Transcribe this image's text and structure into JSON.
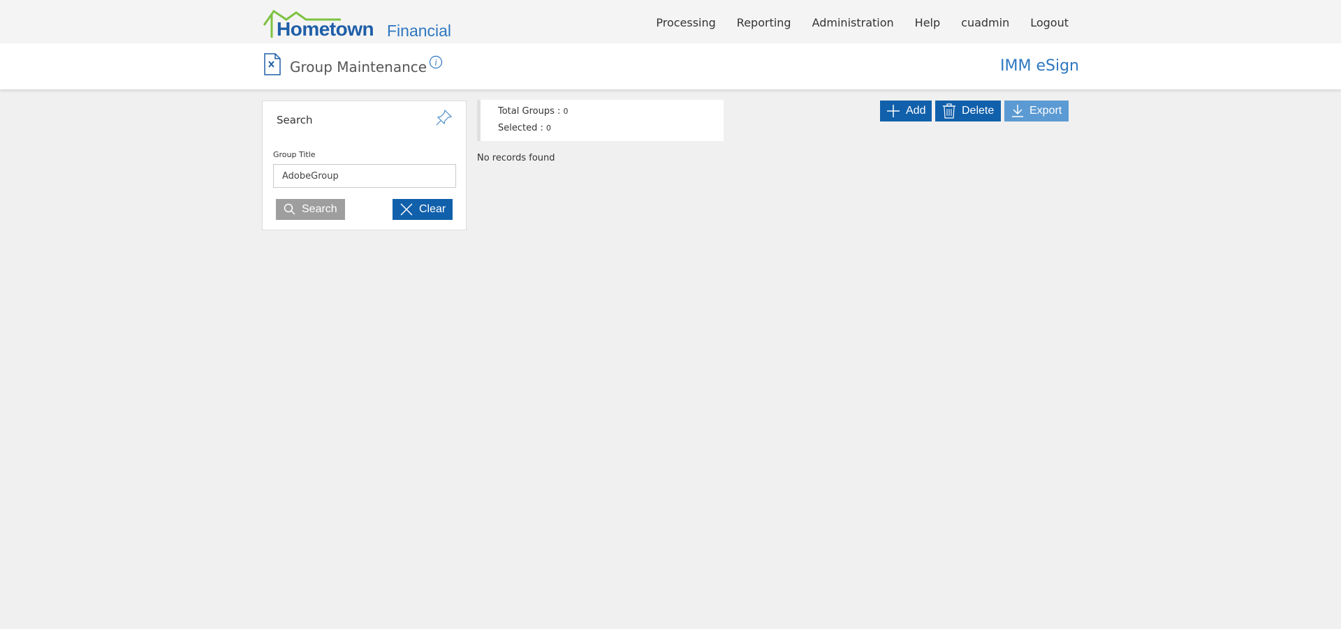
{
  "header": {
    "brand_main": "Hometown",
    "brand_sub": "Financial",
    "nav": [
      "Processing",
      "Reporting",
      "Administration",
      "Help",
      "cuadmin",
      "Logout"
    ]
  },
  "page": {
    "title": "Group Maintenance",
    "app_name": "IMM eSign"
  },
  "search_panel": {
    "title": "Search",
    "field_label": "Group Title",
    "field_value": "AdobeGroup",
    "search_button": "Search",
    "clear_button": "Clear"
  },
  "totals": {
    "total_label": "Total Groups : ",
    "total_value": "0",
    "selected_label": "Selected : ",
    "selected_value": "0"
  },
  "results": {
    "empty_message": "No records found"
  },
  "actions": {
    "add": "Add",
    "delete": "Delete",
    "export": "Export"
  },
  "colors": {
    "primary": "#1160ab",
    "disabled": "#9e9e9e",
    "export": "#5b9ad3",
    "brand_blue": "#1f5fa8",
    "brand_green": "#7cc242"
  }
}
